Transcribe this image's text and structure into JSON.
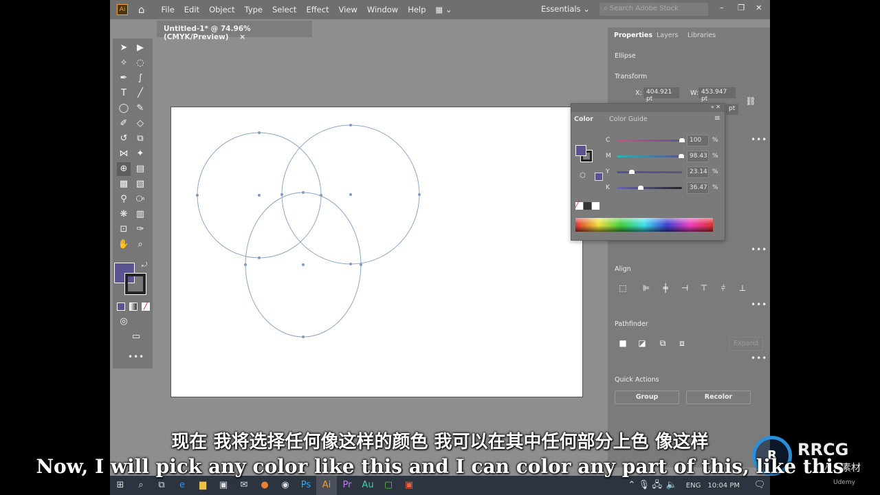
{
  "app": {
    "logo": "Ai",
    "menu": [
      "File",
      "Edit",
      "Object",
      "Type",
      "Select",
      "Effect",
      "View",
      "Window",
      "Help"
    ],
    "workspace": "Essentials",
    "search_placeholder": "Search Adobe Stock"
  },
  "document_tab": {
    "title": "Untitled-1* @ 74.96% (CMYK/Preview)",
    "close": "×"
  },
  "properties": {
    "tabs": [
      "Properties",
      "Layers",
      "Libraries"
    ],
    "selection": "Ellipse",
    "transform_label": "Transform",
    "x_label": "X:",
    "x_value": "404.921 pt",
    "w_label": "W:",
    "w_value": "453.947 pt",
    "h_partial": "pt",
    "align_label": "Align",
    "pathfinder_label": "Pathfinder",
    "expand": "Expand",
    "quick_actions_label": "Quick Actions",
    "group": "Group",
    "recolor": "Recolor"
  },
  "color_panel": {
    "tabs": [
      "Color",
      "Color Guide"
    ],
    "channels": [
      {
        "label": "C",
        "value": "100",
        "pct": 100,
        "unit": "%"
      },
      {
        "label": "M",
        "value": "98.43",
        "pct": 98.43,
        "unit": "%"
      },
      {
        "label": "Y",
        "value": "23.14",
        "pct": 23.14,
        "unit": "%"
      },
      {
        "label": "K",
        "value": "36.47",
        "pct": 36.47,
        "unit": "%"
      }
    ],
    "fill_color": "#5a5490"
  },
  "taskbar": {
    "lang": "ENG",
    "time": "10:04 PM"
  },
  "subtitles": {
    "zh": "现在 我将选择任何像这样的颜色 我可以在其中任何部分上色 像这样",
    "en": "Now, I will pick any color like this and I can color any part of this, like this"
  },
  "watermark": {
    "brand": "RRCG",
    "brand_sub": "人人素材",
    "udemy": "Udemy"
  }
}
